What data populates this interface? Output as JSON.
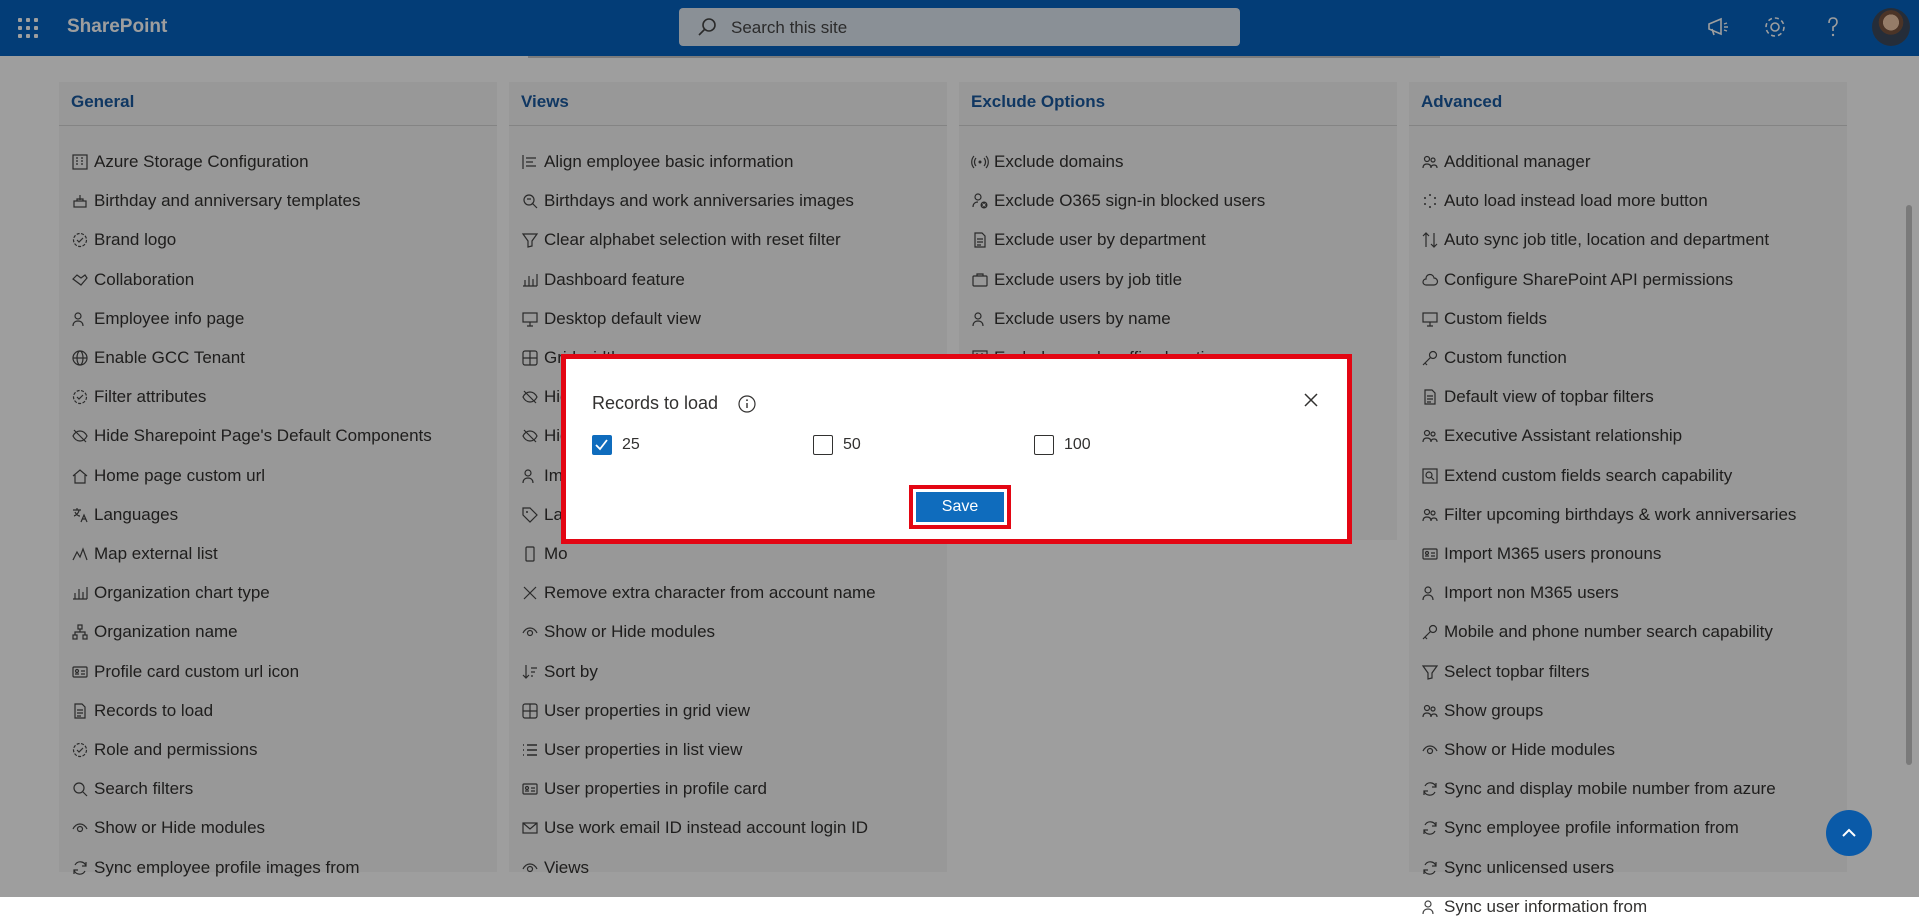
{
  "app": {
    "title": "SharePoint"
  },
  "search": {
    "placeholder": "Search this site"
  },
  "columns": [
    {
      "title": "General",
      "items": [
        {
          "label": "Azure Storage Configuration",
          "icon": "building-icon"
        },
        {
          "label": "Birthday and anniversary templates",
          "icon": "cake-icon"
        },
        {
          "label": "Brand logo",
          "icon": "badge-icon"
        },
        {
          "label": "Collaboration",
          "icon": "handshake-icon"
        },
        {
          "label": "Employee info page",
          "icon": "person-icon"
        },
        {
          "label": "Enable GCC Tenant",
          "icon": "globe-icon"
        },
        {
          "label": "Filter attributes",
          "icon": "badge-icon"
        },
        {
          "label": "Hide Sharepoint Page's Default Components",
          "icon": "eye-off-icon"
        },
        {
          "label": "Home page custom url",
          "icon": "home-icon"
        },
        {
          "label": "Languages",
          "icon": "translate-icon"
        },
        {
          "label": "Map external list",
          "icon": "map-icon"
        },
        {
          "label": "Organization chart type",
          "icon": "chart-icon"
        },
        {
          "label": "Organization name",
          "icon": "org-icon"
        },
        {
          "label": "Profile card custom url icon",
          "icon": "card-icon"
        },
        {
          "label": "Records to load",
          "icon": "document-icon"
        },
        {
          "label": "Role and permissions",
          "icon": "badge-icon"
        },
        {
          "label": "Search filters",
          "icon": "search-icon"
        },
        {
          "label": "Show or Hide modules",
          "icon": "eye-icon"
        },
        {
          "label": "Sync employee profile images from",
          "icon": "sync-icon"
        }
      ]
    },
    {
      "title": "Views",
      "items": [
        {
          "label": "Align employee basic information",
          "icon": "align-icon"
        },
        {
          "label": "Birthdays and work anniversaries images",
          "icon": "image-icon"
        },
        {
          "label": "Clear alphabet selection with reset filter",
          "icon": "filter-icon"
        },
        {
          "label": "Dashboard feature",
          "icon": "chart-icon"
        },
        {
          "label": "Desktop default view",
          "icon": "desktop-icon"
        },
        {
          "label": "Grid width",
          "icon": "grid-icon"
        },
        {
          "label": "Hid",
          "icon": "eye-off-icon"
        },
        {
          "label": "Hid",
          "icon": "eye-off-icon"
        },
        {
          "label": "Ima",
          "icon": "person-icon"
        },
        {
          "label": "Lab",
          "icon": "tag-icon"
        },
        {
          "label": "Mo",
          "icon": "phone-icon"
        },
        {
          "label": "Remove extra character from account name",
          "icon": "close-icon"
        },
        {
          "label": "Show or Hide modules",
          "icon": "eye-icon"
        },
        {
          "label": "Sort by",
          "icon": "sort-icon"
        },
        {
          "label": "User properties in grid view",
          "icon": "grid-icon"
        },
        {
          "label": "User properties in list view",
          "icon": "list-icon"
        },
        {
          "label": "User properties in profile card",
          "icon": "card-icon"
        },
        {
          "label": "Use work email ID instead account login ID",
          "icon": "mail-icon"
        },
        {
          "label": "Views",
          "icon": "eye-icon"
        }
      ]
    },
    {
      "title": "Exclude Options",
      "items": [
        {
          "label": "Exclude domains",
          "icon": "broadcast-icon"
        },
        {
          "label": "Exclude O365 sign-in blocked users",
          "icon": "person-block-icon"
        },
        {
          "label": "Exclude user by department",
          "icon": "document-icon"
        },
        {
          "label": "Exclude users by job title",
          "icon": "briefcase-icon"
        },
        {
          "label": "Exclude users by name",
          "icon": "person-icon"
        },
        {
          "label": "Exclude user by office location",
          "icon": "building-icon"
        }
      ]
    },
    {
      "title": "Advanced",
      "items": [
        {
          "label": "Additional manager",
          "icon": "people-icon"
        },
        {
          "label": "Auto load instead load more button",
          "icon": "spinner-icon"
        },
        {
          "label": "Auto sync job title, location and department",
          "icon": "arrows-icon"
        },
        {
          "label": "Configure SharePoint API permissions",
          "icon": "cloud-icon"
        },
        {
          "label": "Custom fields",
          "icon": "desktop-icon"
        },
        {
          "label": "Custom function",
          "icon": "key-icon"
        },
        {
          "label": "Default view of topbar filters",
          "icon": "document-icon"
        },
        {
          "label": "Executive Assistant relationship",
          "icon": "people-icon"
        },
        {
          "label": "Extend custom fields search capability",
          "icon": "search-box-icon"
        },
        {
          "label": "Filter upcoming birthdays & work anniversaries",
          "icon": "people-icon"
        },
        {
          "label": "Import M365 users pronouns",
          "icon": "card-icon"
        },
        {
          "label": "Import non M365 users",
          "icon": "person-icon"
        },
        {
          "label": "Mobile and phone number search capability",
          "icon": "key-icon"
        },
        {
          "label": "Select topbar filters",
          "icon": "filter-icon"
        },
        {
          "label": "Show groups",
          "icon": "people-icon"
        },
        {
          "label": "Show or Hide modules",
          "icon": "eye-icon"
        },
        {
          "label": "Sync and display mobile number from azure",
          "icon": "sync-icon"
        },
        {
          "label": "Sync employee profile information from",
          "icon": "sync-icon"
        },
        {
          "label": "Sync unlicensed users",
          "icon": "sync-icon"
        },
        {
          "label": "Sync user information from",
          "icon": "person-icon"
        }
      ]
    }
  ],
  "dialog": {
    "title": "Records to load",
    "options": [
      {
        "label": "25",
        "checked": true
      },
      {
        "label": "50",
        "checked": false
      },
      {
        "label": "100",
        "checked": false
      }
    ],
    "save_label": "Save"
  },
  "colors": {
    "suitebar": "#0563c1",
    "accent": "#0f6cbd",
    "highlight": "#e30613",
    "heading": "#1a5a9e"
  }
}
